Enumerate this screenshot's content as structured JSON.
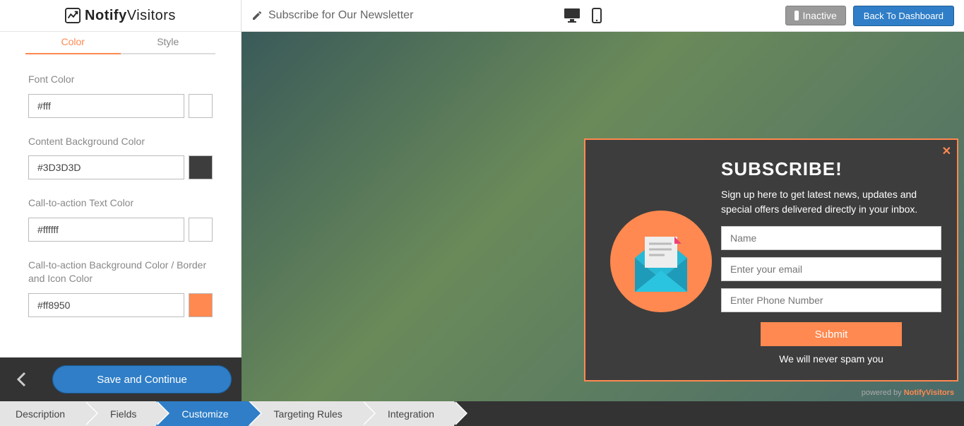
{
  "brand": {
    "name_strong": "Notify",
    "name_light": "Visitors"
  },
  "header": {
    "page_title": "Subscribe for Our Newsletter",
    "status_label": "Inactive",
    "dashboard_btn": "Back To Dashboard"
  },
  "tabs": {
    "color": "Color",
    "style": "Style",
    "active": "color"
  },
  "fields": [
    {
      "label": "Font Color",
      "value": "#fff",
      "swatch": "#ffffff"
    },
    {
      "label": "Content Background Color",
      "value": "#3D3D3D",
      "swatch": "#3d3d3d"
    },
    {
      "label": "Call-to-action Text Color",
      "value": "#ffffff",
      "swatch": "#ffffff"
    },
    {
      "label": "Call-to-action Background Color / Border and Icon Color",
      "value": "#ff8950",
      "swatch": "#ff8950"
    }
  ],
  "save_button": "Save and Continue",
  "popup": {
    "title": "SUBSCRIBE!",
    "desc": "Sign up here to get latest news, updates and special offers delivered directly in your inbox.",
    "placeholders": {
      "name": "Name",
      "email": "Enter your email",
      "phone": "Enter Phone Number"
    },
    "submit": "Submit",
    "footer": "We will never spam you"
  },
  "poweredby": {
    "prefix": "powered by ",
    "brand": "NotifyVisitors"
  },
  "breadcrumbs": [
    "Description",
    "Fields",
    "Customize",
    "Targeting Rules",
    "Integration"
  ],
  "breadcrumb_active_index": 2,
  "colors": {
    "accent": "#ff8950",
    "primary": "#2f7ec7",
    "content_bg": "#3d3d3d"
  }
}
